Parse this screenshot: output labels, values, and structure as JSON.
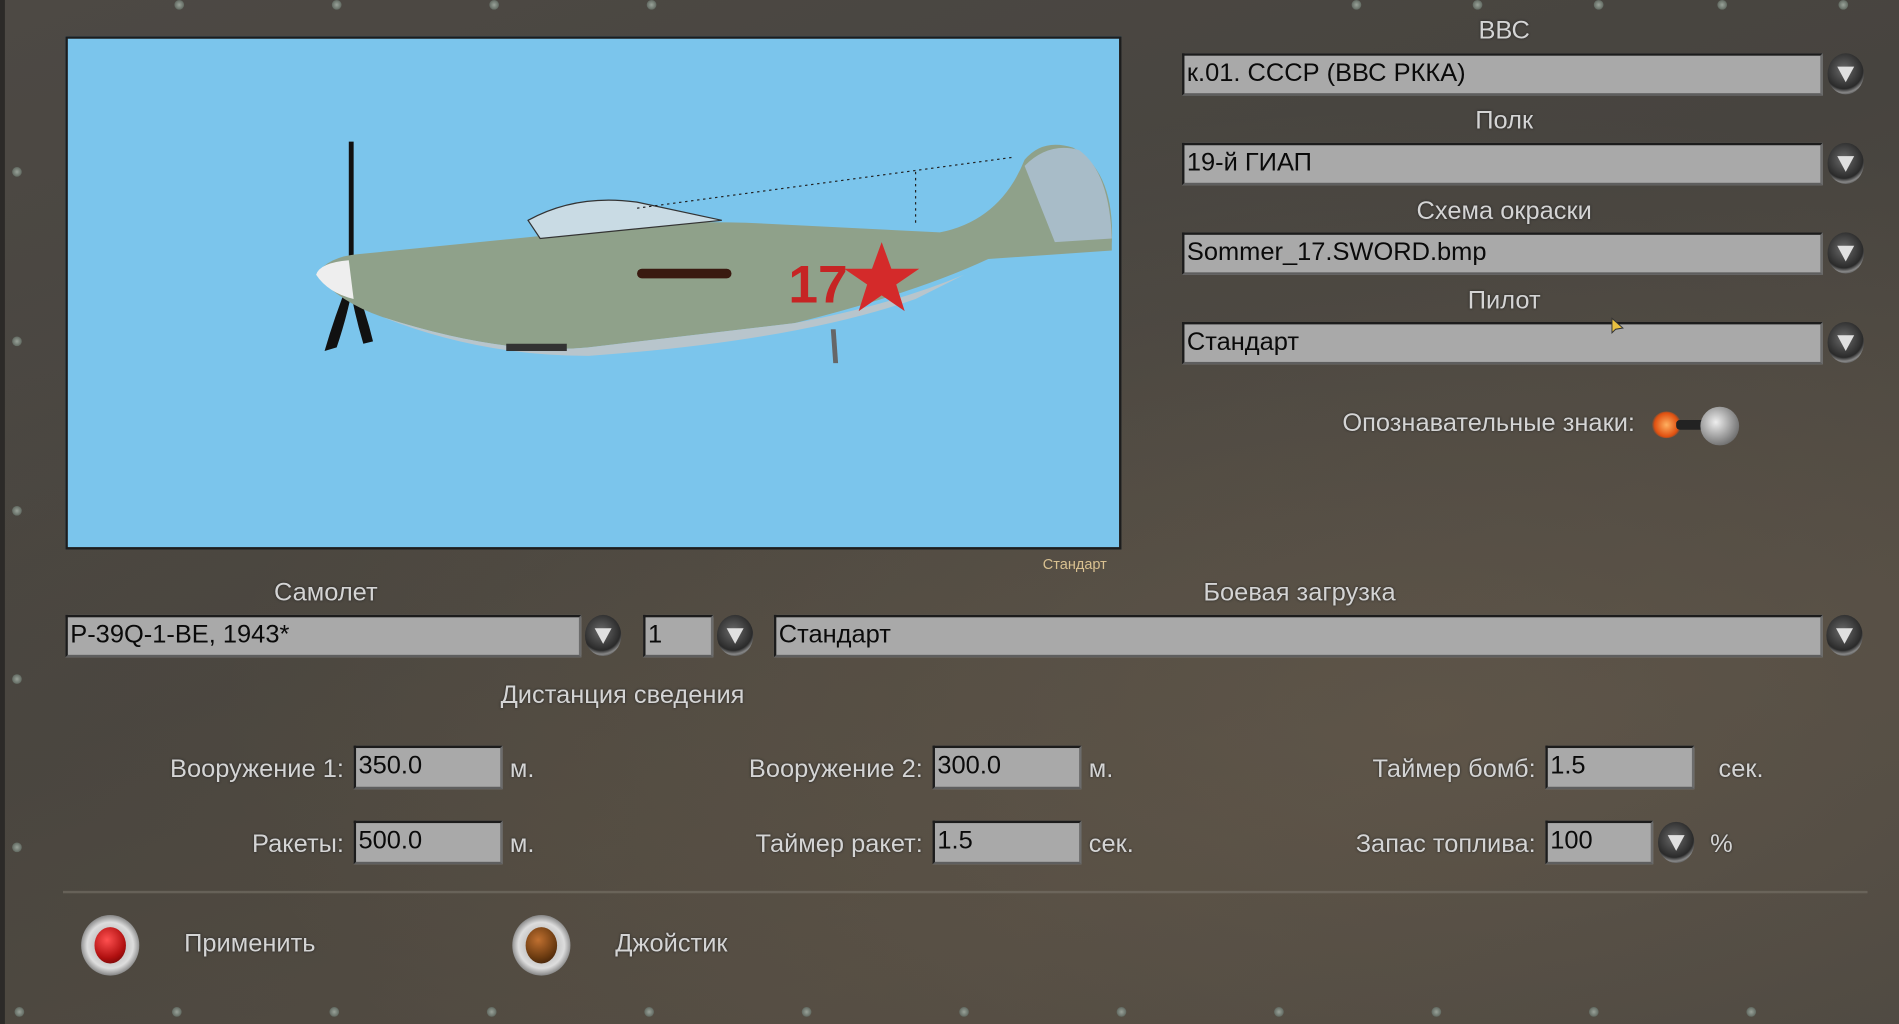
{
  "preview": {
    "skin_caption": "Стандарт",
    "background": "#7bc5ec",
    "marking_number": "17"
  },
  "right": {
    "air_force_label": "ВВС",
    "air_force_value": "к.01. СССР (ВВС РККА)",
    "regiment_label": "Полк",
    "regiment_value": "19-й ГИАП",
    "skin_label": "Схема окраски",
    "skin_value": "Sommer_17.SWORD.bmp",
    "pilot_label": "Пилот",
    "pilot_value": "Стандарт",
    "markings_label": "Опознавательные знаки:"
  },
  "aircraft": {
    "label": "Самолет",
    "value": "P-39Q-1-BE, 1943*",
    "count": "1"
  },
  "loadout": {
    "label": "Боевая загрузка",
    "value": "Стандарт"
  },
  "convergence": {
    "title": "Дистанция сведения",
    "weapon1_label": "Вооружение 1:",
    "weapon1_value": "350.0",
    "weapon1_unit": "м.",
    "weapon2_label": "Вооружение 2:",
    "weapon2_value": "300.0",
    "weapon2_unit": "м.",
    "bomb_timer_label": "Таймер бомб:",
    "bomb_timer_value": "1.5",
    "bomb_timer_unit": "сек.",
    "rockets_label": "Ракеты:",
    "rockets_value": "500.0",
    "rockets_unit": "м.",
    "rocket_timer_label": "Таймер ракет:",
    "rocket_timer_value": "1.5",
    "rocket_timer_unit": "сек.",
    "fuel_label": "Запас топлива:",
    "fuel_value": "100",
    "fuel_unit": "%"
  },
  "footer": {
    "apply_label": "Применить",
    "joystick_label": "Джойстик"
  },
  "colors": {
    "field": "#a9a9a9",
    "label": "#d4d4d4",
    "caption": "#d8c090",
    "apply_led": "#c01818",
    "joystick_led": "#6a3a10"
  }
}
